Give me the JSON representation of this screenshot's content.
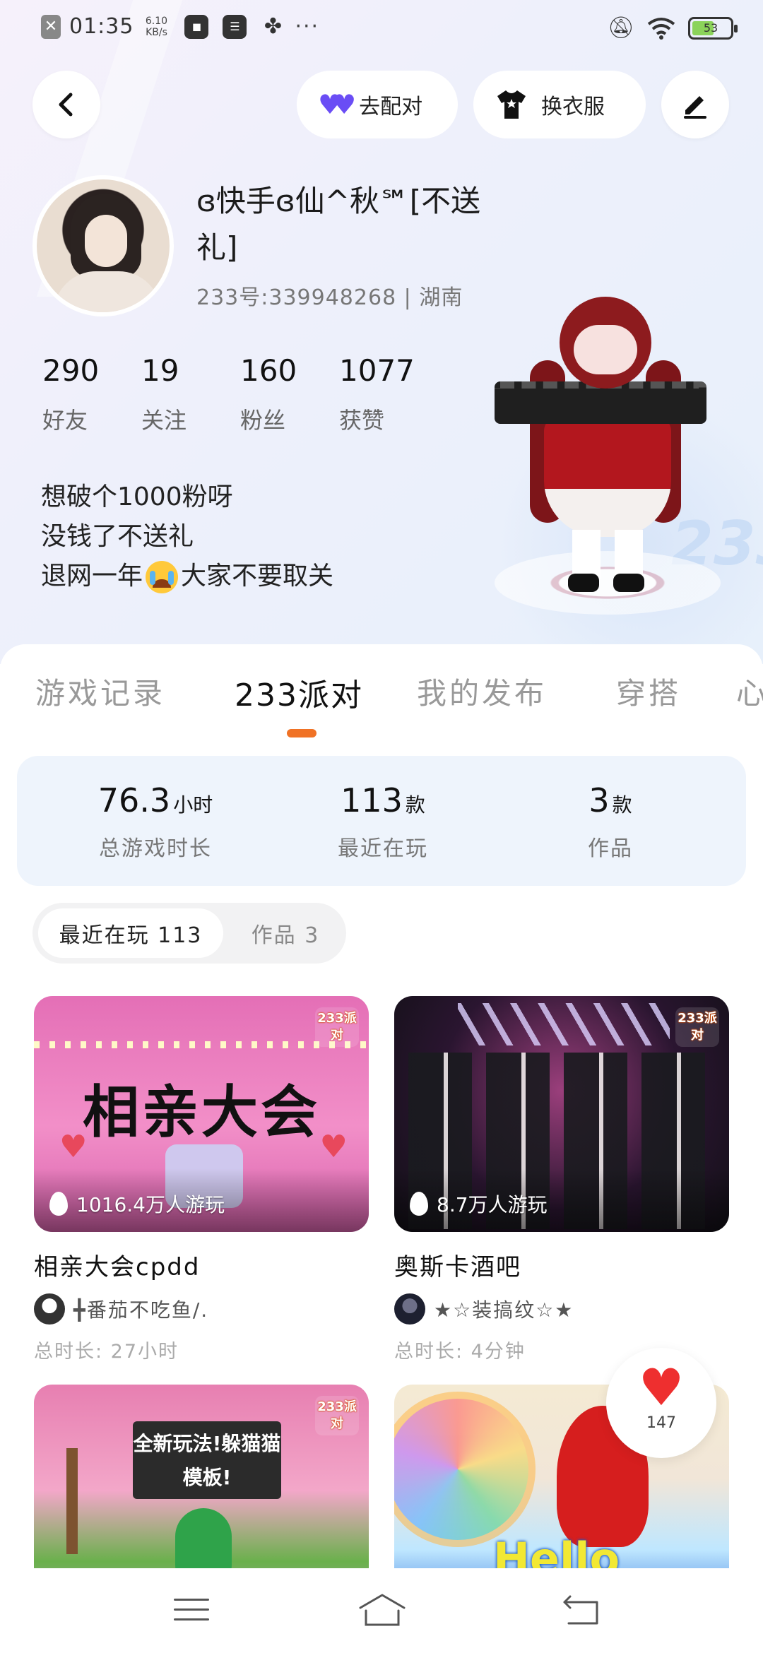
{
  "status_bar": {
    "time": "01:35",
    "speed_value": "6.10",
    "speed_unit": "KB/s",
    "more": "···",
    "battery": "53"
  },
  "top_nav": {
    "match_label": "去配对",
    "dress_label": "换衣服"
  },
  "profile": {
    "nickname": "ɞ快手ɞ仙^秋℠[不送礼]",
    "uid_line": "233号:339948268 | 湖南",
    "stats": [
      {
        "value": "290",
        "label": "好友"
      },
      {
        "value": "19",
        "label": "关注"
      },
      {
        "value": "160",
        "label": "粉丝"
      },
      {
        "value": "1077",
        "label": "获赞"
      }
    ],
    "bio_line1": "想破个1000粉呀",
    "bio_line2": "没钱了不送礼",
    "bio_line3_a": "退网一年",
    "bio_line3_b": "大家不要取关"
  },
  "tabs": [
    {
      "label": "游戏记录"
    },
    {
      "label": "233派对"
    },
    {
      "label": "我的发布"
    },
    {
      "label": "穿搭"
    },
    {
      "label": "心"
    }
  ],
  "summary": {
    "total_time_value": "76.3",
    "total_time_unit": "小时",
    "total_time_label": "总游戏时长",
    "recent_value": "113",
    "recent_unit": "款",
    "recent_label": "最近在玩",
    "works_value": "3",
    "works_unit": "款",
    "works_label": "作品"
  },
  "segment": {
    "recent": "最近在玩 113",
    "works": "作品 3"
  },
  "cards": [
    {
      "banner_text": "相亲大会",
      "badge": "233派对",
      "plays": "1016.4万人游玩",
      "title": "相亲大会cpdd",
      "author": "╋番茄不吃鱼/.",
      "time": "总时长: 27小时"
    },
    {
      "badge": "233派对",
      "plays": "8.7万人游玩",
      "title": "奥斯卡酒吧",
      "author": "★☆装搞纹☆★",
      "time": "总时长: 4分钟"
    },
    {
      "badge": "233派对",
      "banner_text": "全新玩法!躲猫猫模板!"
    },
    {
      "banner_text": "Hello"
    }
  ],
  "float_like": {
    "count": "147"
  },
  "colors": {
    "accent": "#f07225",
    "summary_bg": "#eef4fc",
    "like_red": "#ee2f2f",
    "match_heart": "#6a4df5"
  }
}
